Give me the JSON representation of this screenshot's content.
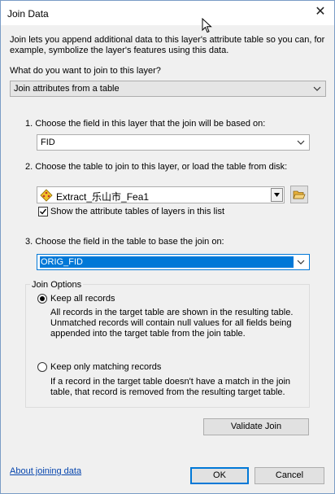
{
  "window": {
    "title": "Join Data"
  },
  "intro": "Join lets you append additional data to this layer's attribute table so you can, for example, symbolize the layer's features using this data.",
  "question": "What do you want to join to this layer?",
  "join_type": {
    "value": "Join attributes from a table"
  },
  "step1": {
    "label": "1.  Choose the field in this layer that the join will be based on:",
    "value": "FID"
  },
  "step2": {
    "label": "2.  Choose the table to join to this layer, or load the table from disk:",
    "value": "Extract_乐山市_Fea1",
    "checkbox_label": "Show the attribute tables of layers in this list",
    "checkbox_checked": true
  },
  "step3": {
    "label": "3.  Choose the field in the table to base the join on:",
    "value": "ORIG_FID"
  },
  "join_options": {
    "title": "Join Options",
    "keep_all": {
      "label": "Keep all records",
      "selected": true,
      "desc": "All records in the target table are shown in the resulting table. Unmatched records will contain null values for all fields being appended into the target table from the join table."
    },
    "keep_matching": {
      "label": "Keep only matching records",
      "selected": false,
      "desc": "If a record in the target table doesn't have a match in the join table, that record is removed from the resulting target table."
    }
  },
  "buttons": {
    "validate": "Validate Join",
    "ok": "OK",
    "cancel": "Cancel"
  },
  "link": "About joining data"
}
